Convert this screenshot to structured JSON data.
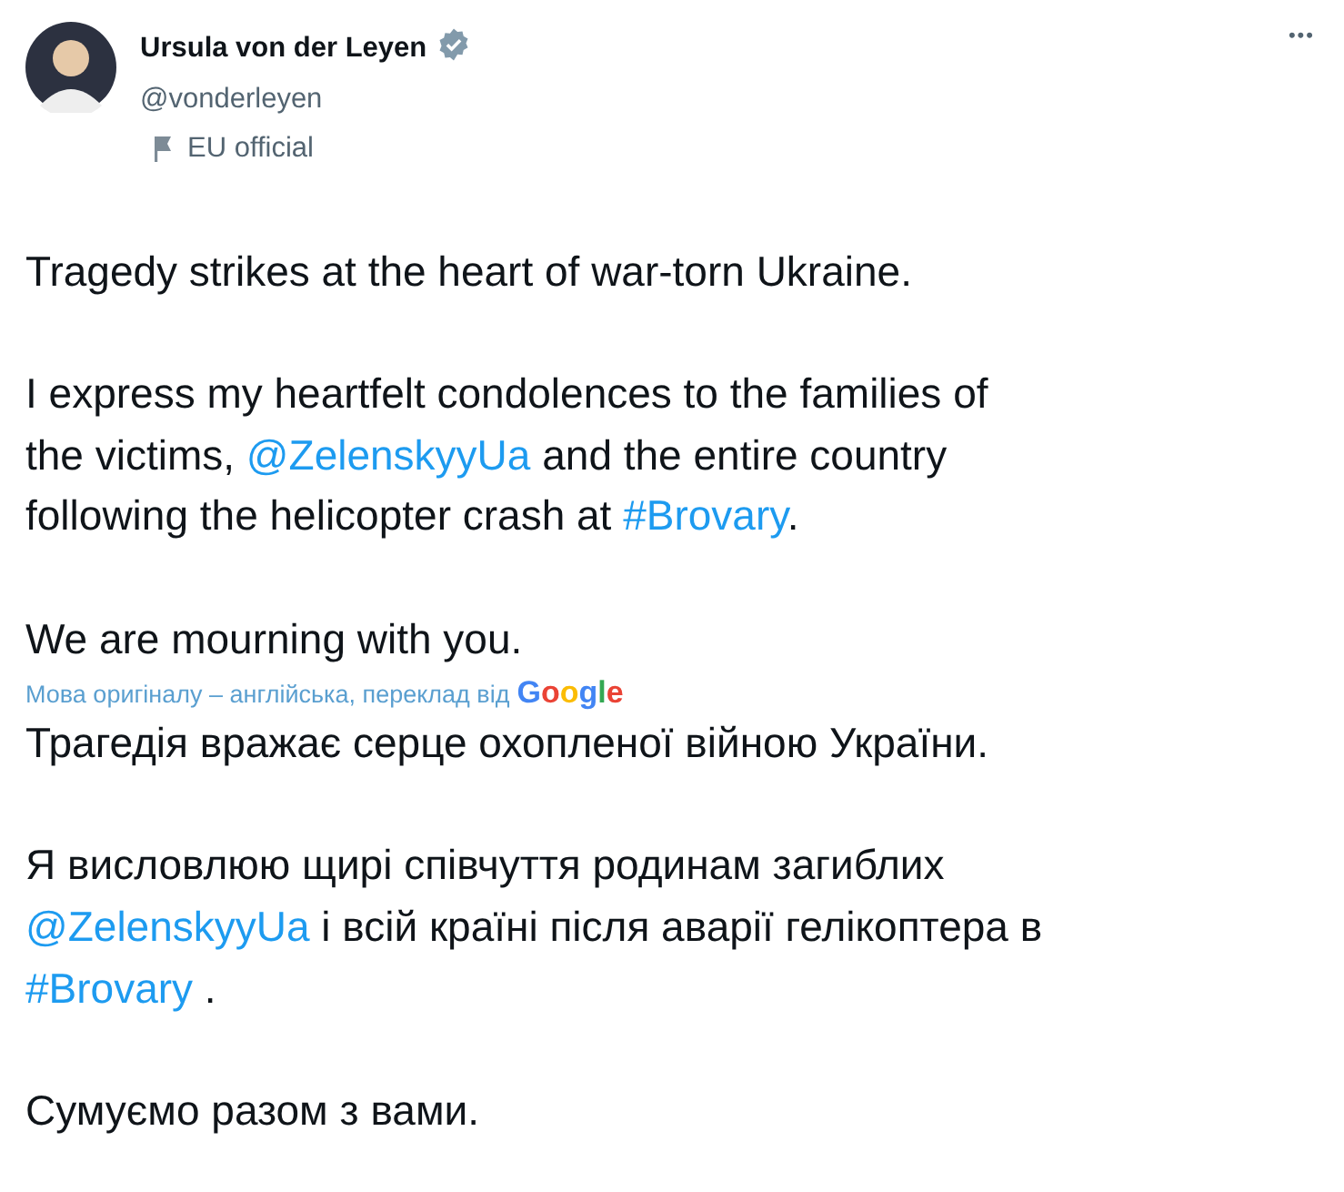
{
  "author": {
    "name": "Ursula von der Leyen",
    "verified": true,
    "handle": "@vonderleyen",
    "label": "EU official"
  },
  "menu": "•••",
  "tweet": [
    [
      [
        {
          "kind": "plain",
          "text": "Tragedy strikes at the heart of war-torn Ukraine."
        }
      ]
    ],
    [
      [
        {
          "kind": "plain",
          "text": "I express my heartfelt condolences to the families of"
        }
      ],
      [
        {
          "kind": "plain",
          "text": "the victims, "
        },
        {
          "kind": "link",
          "text": "@ZelenskyyUa"
        },
        {
          "kind": "plain",
          "text": " and the entire country"
        }
      ],
      [
        {
          "kind": "plain",
          "text": "following the helicopter crash at "
        },
        {
          "kind": "link",
          "text": "#Brovary"
        },
        {
          "kind": "plain",
          "text": "."
        }
      ]
    ],
    [
      [
        {
          "kind": "plain",
          "text": "We are mourning with you."
        }
      ]
    ]
  ],
  "translation_note": {
    "text": "Мова оригіналу – англійська, переклад від",
    "provider": "Google"
  },
  "translation": [
    [
      [
        {
          "kind": "plain",
          "text": "Трагедія вражає серце охопленої війною України."
        }
      ]
    ],
    [
      [
        {
          "kind": "plain",
          "text": "Я висловлюю щирі співчуття родинам загиблих"
        }
      ],
      [
        {
          "kind": "link",
          "text": "@ZelenskyyUa"
        },
        {
          "kind": "plain",
          "text": " і всій країні після аварії гелікоптера в"
        }
      ],
      [
        {
          "kind": "link",
          "text": "#Brovary"
        },
        {
          "kind": "plain",
          "text": " ."
        }
      ]
    ],
    [
      [
        {
          "kind": "plain",
          "text": "Сумуємо разом з вами."
        }
      ]
    ]
  ]
}
